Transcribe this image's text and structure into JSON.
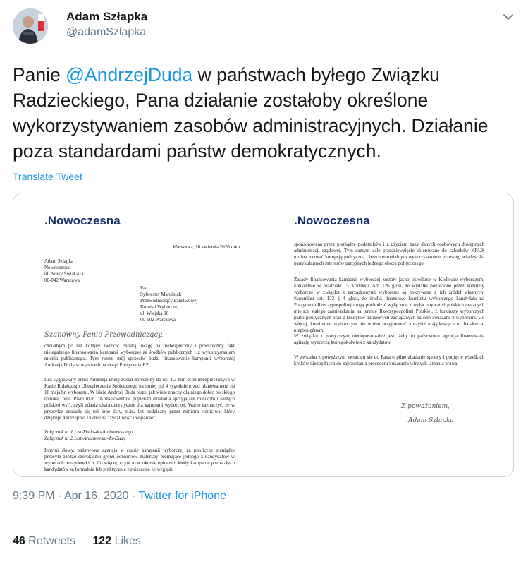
{
  "author": {
    "name": "Adam Szłapka",
    "handle": "@adamSzlapka"
  },
  "tweet": {
    "text_before": "Panie ",
    "mention": "@AndrzejDuda",
    "text_after": " w państwach byłego Związku Radzieckiego, Pana działanie zostałoby określone wykorzystywaniem zasobów administracyjnych. Działanie poza standardami państw demokratycznych.",
    "translate_label": "Translate Tweet"
  },
  "letter": {
    "logo": ".Nowoczesna",
    "date": "Warszawa, 16 kwietnia 2020 roku",
    "sender": [
      "Adam Szłapka",
      "Nowoczesna",
      "ul. Nowy Świat 41a",
      "00-042 Warszawa"
    ],
    "recipient": [
      "Pan",
      "Sylwester Marciniak",
      "Przewodniczący Państwowej",
      "Komisji Wyborczej",
      "ul. Wiejska 10",
      "00-902 Warszawa"
    ],
    "salutation": "Szanowny Panie Przewodniczący,",
    "p1": "chciałbym po raz kolejny zwrócić Pańską uwagę na niebezpieczny i powszechny fakt nielegalnego finansowania kampanii wyborczej ze środków publicznych i z wykorzystaniem mienia publicznego. Tym razem mój sprzeciw budzi finansowanie kampanii wyborczej Andrzeja Dudy w wyborach na urząd Prezydenta RP.",
    "p2": "List sygnowany przez Andrzeja Dudę został doręczony do ok. 1,3 mln osób ubezpieczonych w Kasie Rolniczego Ubezpieczenia Społecznego na mniej niż 4 tygodnie przed planowanymi na 10 maja br. wyborami. W liście Andrzej Duda pisze, jak wiele znaczy dla niego dobro polskiego rolnika i wsi. Pisze m.in. \"Konsekwentnie popieram działania sprzyjające rolnikom i służące polskiej wsi\", czyli zdania charakterystyczne dla kampanii wyborczej. Warto zaznaczyć, że w przesyłce znalazły się też inne listy, m.in. list podpisany przez ministra rolnictwa, który dziękuje Andrzejowi Dudzie za \"życzliwość i wsparcie\".",
    "attach1": "Załącznik nr 1 List-Duda-do-Ardanowskiego",
    "attach2": "Załącznik nr 2 List-Ardanowski-do-Dudy",
    "p3": "Innymi słowy, państwowa agencja w czasie kampanii wyborczej za publiczne pieniądze przesyła bardzo szerokiemu gronu odbiorców materiały promujące jednego z kandydatów w wyborach prezydenckich. Co więcej, czyni to w okresie epidemii, kiedy kampanie pozostałych kandydatów są formalnie lub praktycznie zawieszone ze względu",
    "r1": "sponsorowana przez pieniądze podatników i z użyciem bazy danych osobowych dostępnych administracji rządowej. Tym samym całe przedsięwzięcie skierowane do członków KRUS można nazwać korupcją polityczną i bezceremonialnym wykorzystaniem przewagi władzy dla partykularnych interesów partyjnych jednego obozu politycznego.",
    "r2": "Zasady finansowania kampanii wyborczej zostały jasno określone w Kodeksie wyborczym, konkretnie w rozdziale 15 Kodeksu. Art. 126 głosi, że wydatki ponoszone przez komitety wyborcze w związku z zarządzonymi wyborami są pokrywane z ich źródeł własnych. Natomiast art. 132 § 4 głosi, że środki finansowe komitetu wyborczego kandydata na Prezydenta Rzeczypospolitej mogą pochodzić wyłącznie z wpłat obywateli polskich mających miejsce stałego zamieszkania na terenie Rzeczypospolitej Polskiej, z funduszy wyborczych partii politycznych oraz z kredytów bankowych zaciąganych na cele związane z wyborami. Co więcej, komitetom wyborczym nie wolno przyjmować korzyści majątkowych o charakterze niepieniężnym.",
    "r3": "W związku z powyższym niedopuszczalne jest, żeby to państwowa agencja finansowała agitację wyborczą któregokolwiek z kandydatów.",
    "r4": "W związku z powyższym zwracam się do Pana o pilne zbadanie sprawy i podjęcie wszelkich kroków niezbędnych do zaprzestania procederu i ukarania winnych łamania prawa.",
    "closing": "Z poważaniem,",
    "signature": "Adam Szłapka"
  },
  "meta": {
    "time": "9:39 PM",
    "sep": " · ",
    "date": "Apr 16, 2020",
    "source": "Twitter for iPhone"
  },
  "stats": {
    "retweets_count": "46",
    "retweets_label": "Retweets",
    "likes_count": "122",
    "likes_label": "Likes"
  },
  "colors": {
    "link": "#1b95e0",
    "text": "#14171a",
    "muted": "#657786",
    "logo": "#16306b"
  }
}
